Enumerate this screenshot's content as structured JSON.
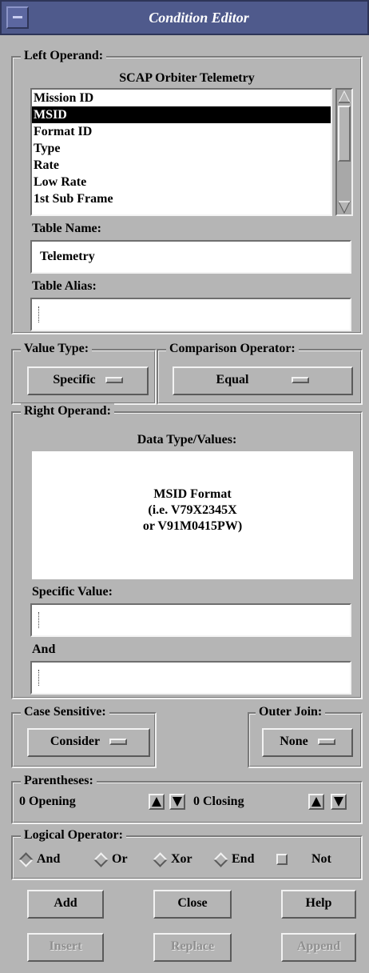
{
  "window": {
    "title": "Condition Editor"
  },
  "left_operand": {
    "legend": "Left Operand:",
    "list_title": "SCAP Orbiter Telemetry",
    "items": [
      "Mission ID",
      "MSID",
      "Format ID",
      "Type",
      "Rate",
      "Low Rate",
      "1st Sub Frame"
    ],
    "selected": "MSID",
    "table_name_label": "Table Name:",
    "table_name_value": "Telemetry",
    "table_alias_label": "Table Alias:",
    "table_alias_value": ""
  },
  "value_type": {
    "legend": "Value Type:",
    "selected": "Specific"
  },
  "comparison_operator": {
    "legend": "Comparison Operator:",
    "selected": "Equal"
  },
  "right_operand": {
    "legend": "Right Operand:",
    "data_type_label": "Data Type/Values:",
    "format_line1": "MSID Format",
    "format_line2": "(i.e. V79X2345X",
    "format_line3": "or V91M0415PW)",
    "specific_value_label": "Specific Value:",
    "specific_value": "",
    "and_label": "And",
    "and_value": ""
  },
  "case_sensitive": {
    "legend": "Case Sensitive:",
    "selected": "Consider"
  },
  "outer_join": {
    "legend": "Outer Join:",
    "selected": "None"
  },
  "parentheses": {
    "legend": "Parentheses:",
    "opening": "0 Opening",
    "closing": "0 Closing"
  },
  "logical_operator": {
    "legend": "Logical Operator:",
    "options": [
      "And",
      "Or",
      "Xor",
      "End"
    ],
    "not_label": "Not",
    "selected": "And",
    "not_checked": false
  },
  "buttons": {
    "add": "Add",
    "close": "Close",
    "help": "Help",
    "insert": "Insert",
    "replace": "Replace",
    "append": "Append"
  }
}
